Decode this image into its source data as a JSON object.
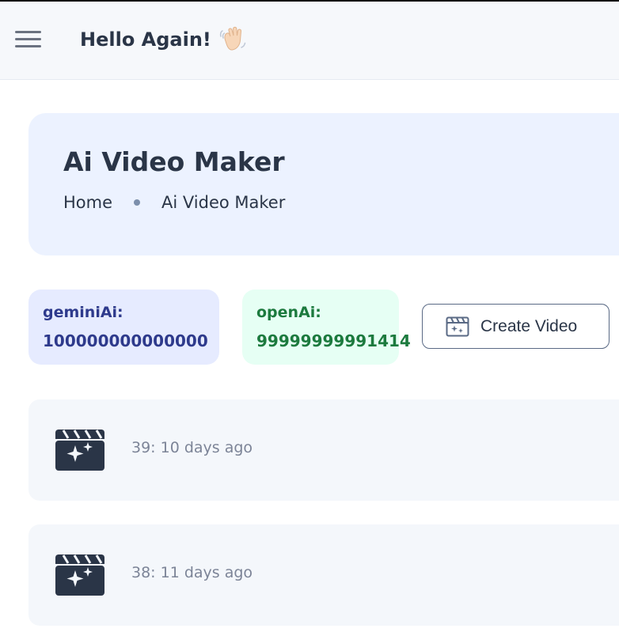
{
  "header": {
    "greeting": "Hello Again!",
    "wave_icon": "waving-hand-icon",
    "menu_icon": "hamburger-menu-icon"
  },
  "hero": {
    "title": "Ai Video Maker",
    "breadcrumb": [
      "Home",
      "Ai Video Maker"
    ]
  },
  "credits": [
    {
      "label": "geminiAi:",
      "value": "100000000000000",
      "color": "#2e3a8c",
      "background": "#e6ebff"
    },
    {
      "label": "openAi:",
      "value": "99999999991414",
      "color": "#1c7a3e",
      "background": "#e6fff4"
    }
  ],
  "actions": {
    "create_label": "Create Video",
    "create_icon": "video-sparkle-icon"
  },
  "videos": [
    {
      "text": "39: 10 days ago",
      "icon": "video-sparkle-icon"
    },
    {
      "text": "38: 11 days ago",
      "icon": "video-sparkle-icon"
    }
  ],
  "colors": {
    "text_primary": "#2a3547",
    "text_muted": "#7c8497",
    "hero_background": "#ecf2ff",
    "card_background": "#f4f7fb"
  }
}
